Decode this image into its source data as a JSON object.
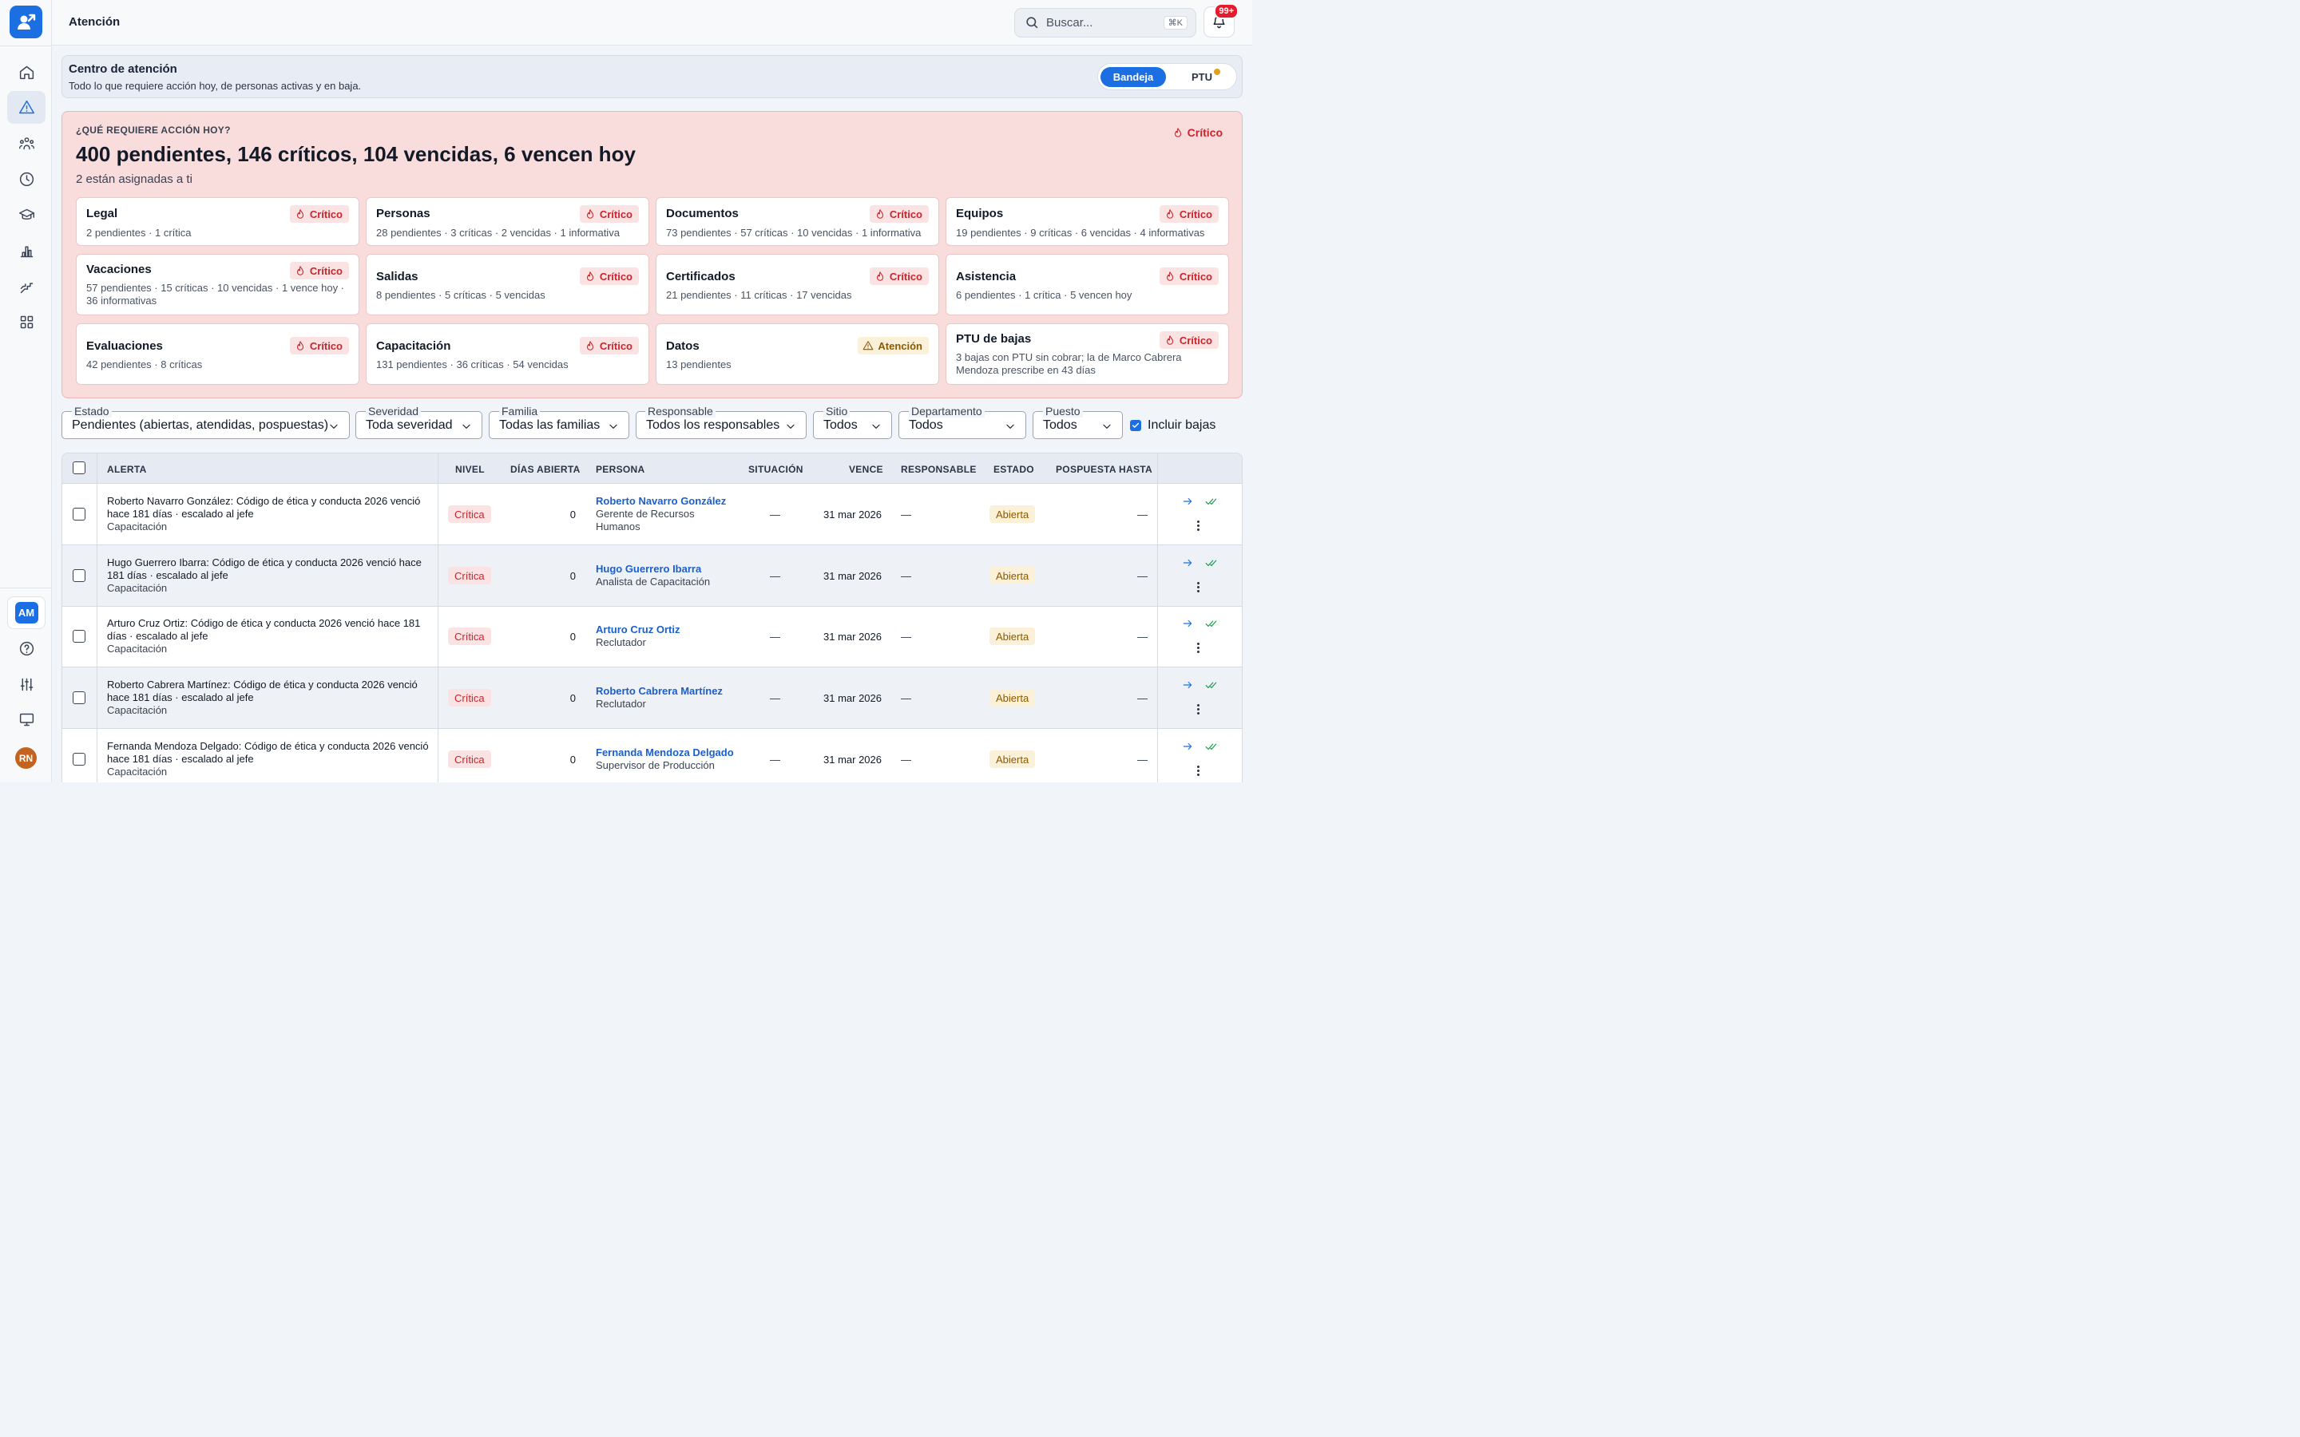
{
  "header": {
    "title": "Atención",
    "search_placeholder": "Buscar...",
    "search_shortcut": "⌘K",
    "notifications_badge": "99+"
  },
  "sidebar": {
    "items": [
      {
        "icon": "home-icon"
      },
      {
        "icon": "alert-icon",
        "active": true
      },
      {
        "icon": "people-icon"
      },
      {
        "icon": "clock-icon"
      },
      {
        "icon": "graduation-icon"
      },
      {
        "icon": "chart-icon"
      },
      {
        "icon": "org-chart-icon"
      },
      {
        "icon": "apps-icon"
      }
    ],
    "user_initials_workspace": "AM",
    "user_initials": "RN"
  },
  "intro": {
    "title": "Centro de atención",
    "subtitle": "Todo lo que requiere acción hoy, de personas activas y en baja.",
    "toggle_on": "Bandeja",
    "toggle_off": "PTU"
  },
  "summary": {
    "kicker": "¿QUÉ REQUIERE ACCIÓN HOY?",
    "headline": "400 pendientes, 146 críticos, 104 vencidas, 6 vencen hoy",
    "assigned": "2 están asignadas a ti",
    "severity": "Crítico"
  },
  "categories": [
    {
      "title": "Legal",
      "desc": "2 pendientes · 1 crítica",
      "chip": "Crítico",
      "kind": "crit"
    },
    {
      "title": "Personas",
      "desc": "28 pendientes · 3 críticas · 2 vencidas · 1 informativa",
      "chip": "Crítico",
      "kind": "crit"
    },
    {
      "title": "Documentos",
      "desc": "73 pendientes · 57 críticas · 10 vencidas · 1 informativa",
      "chip": "Crítico",
      "kind": "crit"
    },
    {
      "title": "Equipos",
      "desc": "19 pendientes · 9 críticas · 6 vencidas · 4 informativas",
      "chip": "Crítico",
      "kind": "crit"
    },
    {
      "title": "Vacaciones",
      "desc": "57 pendientes · 15 críticas · 10 vencidas · 1 vence hoy · 36 informativas",
      "chip": "Crítico",
      "kind": "crit"
    },
    {
      "title": "Salidas",
      "desc": "8 pendientes · 5 críticas · 5 vencidas",
      "chip": "Crítico",
      "kind": "crit"
    },
    {
      "title": "Certificados",
      "desc": "21 pendientes · 11 críticas · 17 vencidas",
      "chip": "Crítico",
      "kind": "crit"
    },
    {
      "title": "Asistencia",
      "desc": "6 pendientes · 1 crítica · 5 vencen hoy",
      "chip": "Crítico",
      "kind": "crit"
    },
    {
      "title": "Evaluaciones",
      "desc": "42 pendientes · 8 críticas",
      "chip": "Crítico",
      "kind": "crit"
    },
    {
      "title": "Capacitación",
      "desc": "131 pendientes · 36 críticas · 54 vencidas",
      "chip": "Crítico",
      "kind": "crit"
    },
    {
      "title": "Datos",
      "desc": "13 pendientes",
      "chip": "Atención",
      "kind": "warn"
    },
    {
      "title": "PTU de bajas",
      "desc": "3 bajas con PTU sin cobrar; la de Marco Cabrera Mendoza prescribe en 43 días",
      "chip": "Crítico",
      "kind": "crit"
    }
  ],
  "filters": {
    "estado": {
      "label": "Estado",
      "value": "Pendientes (abiertas, atendidas, pospuestas)"
    },
    "severidad": {
      "label": "Severidad",
      "value": "Toda severidad"
    },
    "familia": {
      "label": "Familia",
      "value": "Todas las familias"
    },
    "responsable": {
      "label": "Responsable",
      "value": "Todos los responsables"
    },
    "sitio": {
      "label": "Sitio",
      "value": "Todos"
    },
    "departamento": {
      "label": "Departamento",
      "value": "Todos"
    },
    "puesto": {
      "label": "Puesto",
      "value": "Todos"
    },
    "incluir_bajas": {
      "label": "Incluir bajas",
      "checked": true
    }
  },
  "table": {
    "columns": {
      "alerta": "ALERTA",
      "nivel": "NIVEL",
      "dias": "DÍAS ABIERTA",
      "persona": "PERSONA",
      "situacion": "SITUACIÓN",
      "vence": "VENCE",
      "responsable": "RESPONSABLE",
      "estado": "ESTADO",
      "pospuesta": "POSPUESTA HASTA"
    },
    "rows": [
      {
        "alerta": "Roberto Navarro González: Código de ética y conducta 2026 venció hace 181 días · escalado al jefe",
        "familia": "Capacitación",
        "nivel": "Crítica",
        "dias": "0",
        "persona": "Roberto Navarro González",
        "puesto": "Gerente de Recursos Humanos",
        "situacion": "—",
        "vence": "31 mar 2026",
        "responsable": "—",
        "estado": "Abierta",
        "pospuesta": "—"
      },
      {
        "alerta": "Hugo Guerrero Ibarra: Código de ética y conducta 2026 venció hace 181 días · escalado al jefe",
        "familia": "Capacitación",
        "nivel": "Crítica",
        "dias": "0",
        "persona": "Hugo Guerrero Ibarra",
        "puesto": "Analista de Capacitación",
        "situacion": "—",
        "vence": "31 mar 2026",
        "responsable": "—",
        "estado": "Abierta",
        "pospuesta": "—"
      },
      {
        "alerta": "Arturo Cruz Ortiz: Código de ética y conducta 2026 venció hace 181 días · escalado al jefe",
        "familia": "Capacitación",
        "nivel": "Crítica",
        "dias": "0",
        "persona": "Arturo Cruz Ortiz",
        "puesto": "Reclutador",
        "situacion": "—",
        "vence": "31 mar 2026",
        "responsable": "—",
        "estado": "Abierta",
        "pospuesta": "—"
      },
      {
        "alerta": "Roberto Cabrera Martínez: Código de ética y conducta 2026 venció hace 181 días · escalado al jefe",
        "familia": "Capacitación",
        "nivel": "Crítica",
        "dias": "0",
        "persona": "Roberto Cabrera Martínez",
        "puesto": "Reclutador",
        "situacion": "—",
        "vence": "31 mar 2026",
        "responsable": "—",
        "estado": "Abierta",
        "pospuesta": "—"
      },
      {
        "alerta": "Fernanda Mendoza Delgado: Código de ética y conducta 2026 venció hace 181 días · escalado al jefe",
        "familia": "Capacitación",
        "nivel": "Crítica",
        "dias": "0",
        "persona": "Fernanda Mendoza Delgado",
        "puesto": "Supervisor de Producción",
        "situacion": "—",
        "vence": "31 mar 2026",
        "responsable": "—",
        "estado": "Abierta",
        "pospuesta": "—"
      }
    ]
  }
}
